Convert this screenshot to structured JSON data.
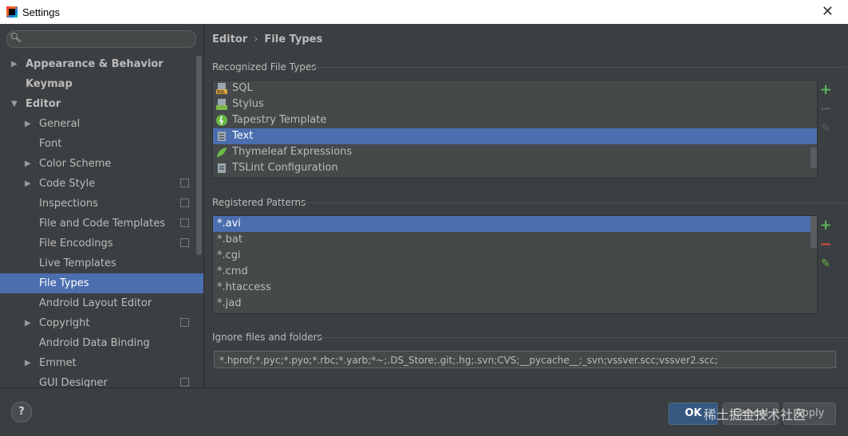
{
  "window": {
    "title": "Settings",
    "close_glyph": "✕"
  },
  "sidebar": {
    "search": {
      "placeholder": "",
      "value": ""
    },
    "items": [
      {
        "label": "Appearance & Behavior",
        "arrow": "▶",
        "level": 0,
        "bold": true,
        "selected": false,
        "cfg": false
      },
      {
        "label": "Keymap",
        "arrow": "",
        "level": 0,
        "bold": true,
        "selected": false,
        "cfg": false
      },
      {
        "label": "Editor",
        "arrow": "▼",
        "level": 0,
        "bold": true,
        "selected": false,
        "cfg": false
      },
      {
        "label": "General",
        "arrow": "▶",
        "level": 1,
        "bold": false,
        "selected": false,
        "cfg": false
      },
      {
        "label": "Font",
        "arrow": "",
        "level": 1,
        "bold": false,
        "selected": false,
        "cfg": false
      },
      {
        "label": "Color Scheme",
        "arrow": "▶",
        "level": 1,
        "bold": false,
        "selected": false,
        "cfg": false
      },
      {
        "label": "Code Style",
        "arrow": "▶",
        "level": 1,
        "bold": false,
        "selected": false,
        "cfg": true
      },
      {
        "label": "Inspections",
        "arrow": "",
        "level": 1,
        "bold": false,
        "selected": false,
        "cfg": true
      },
      {
        "label": "File and Code Templates",
        "arrow": "",
        "level": 1,
        "bold": false,
        "selected": false,
        "cfg": true
      },
      {
        "label": "File Encodings",
        "arrow": "",
        "level": 1,
        "bold": false,
        "selected": false,
        "cfg": true
      },
      {
        "label": "Live Templates",
        "arrow": "",
        "level": 1,
        "bold": false,
        "selected": false,
        "cfg": false
      },
      {
        "label": "File Types",
        "arrow": "",
        "level": 1,
        "bold": false,
        "selected": true,
        "cfg": false
      },
      {
        "label": "Android Layout Editor",
        "arrow": "",
        "level": 1,
        "bold": false,
        "selected": false,
        "cfg": false
      },
      {
        "label": "Copyright",
        "arrow": "▶",
        "level": 1,
        "bold": false,
        "selected": false,
        "cfg": true
      },
      {
        "label": "Android Data Binding",
        "arrow": "",
        "level": 1,
        "bold": false,
        "selected": false,
        "cfg": false
      },
      {
        "label": "Emmet",
        "arrow": "▶",
        "level": 1,
        "bold": false,
        "selected": false,
        "cfg": false
      },
      {
        "label": "GUI Designer",
        "arrow": "",
        "level": 1,
        "bold": false,
        "selected": false,
        "cfg": true
      }
    ]
  },
  "main": {
    "breadcrumb": {
      "part1": "Editor",
      "sep": "›",
      "part2": "File Types"
    },
    "recognized": {
      "title": "Recognized File Types",
      "items": [
        {
          "label": "SQL",
          "icon": "sql-file-icon",
          "selected": false
        },
        {
          "label": "Stylus",
          "icon": "stylus-file-icon",
          "selected": false
        },
        {
          "label": "Tapestry Template",
          "icon": "tapestry-icon",
          "selected": false
        },
        {
          "label": "Text",
          "icon": "text-file-icon",
          "selected": true
        },
        {
          "label": "Thymeleaf Expressions",
          "icon": "thymeleaf-leaf-icon",
          "selected": false
        },
        {
          "label": "TSLint Configuration",
          "icon": "tslint-icon",
          "selected": false
        }
      ]
    },
    "patterns": {
      "title": "Registered Patterns",
      "items": [
        {
          "label": "*.avi",
          "selected": true
        },
        {
          "label": "*.bat",
          "selected": false
        },
        {
          "label": "*.cgi",
          "selected": false
        },
        {
          "label": "*.cmd",
          "selected": false
        },
        {
          "label": "*.htaccess",
          "selected": false
        },
        {
          "label": "*.jad",
          "selected": false
        }
      ]
    },
    "ignore": {
      "title": "Ignore files and folders",
      "value": "*.hprof;*.pyc;*.pyo;*.rbc;*.yarb;*~;.DS_Store;.git;.hg;.svn;CVS;__pycache__;_svn;vssver.scc;vssver2.scc;"
    },
    "tool_glyphs": {
      "add": "+",
      "remove": "−",
      "edit": "✎"
    }
  },
  "footer": {
    "help_label": "?",
    "ok_label": "OK",
    "cancel_label": "Cancel",
    "apply_label": "Apply",
    "watermark": "稀土掘金技术社区"
  },
  "colors": {
    "selection": "#4b6eaf",
    "background": "#3c3f41",
    "add_green": "#58b55b",
    "remove_red": "#d24c47"
  }
}
